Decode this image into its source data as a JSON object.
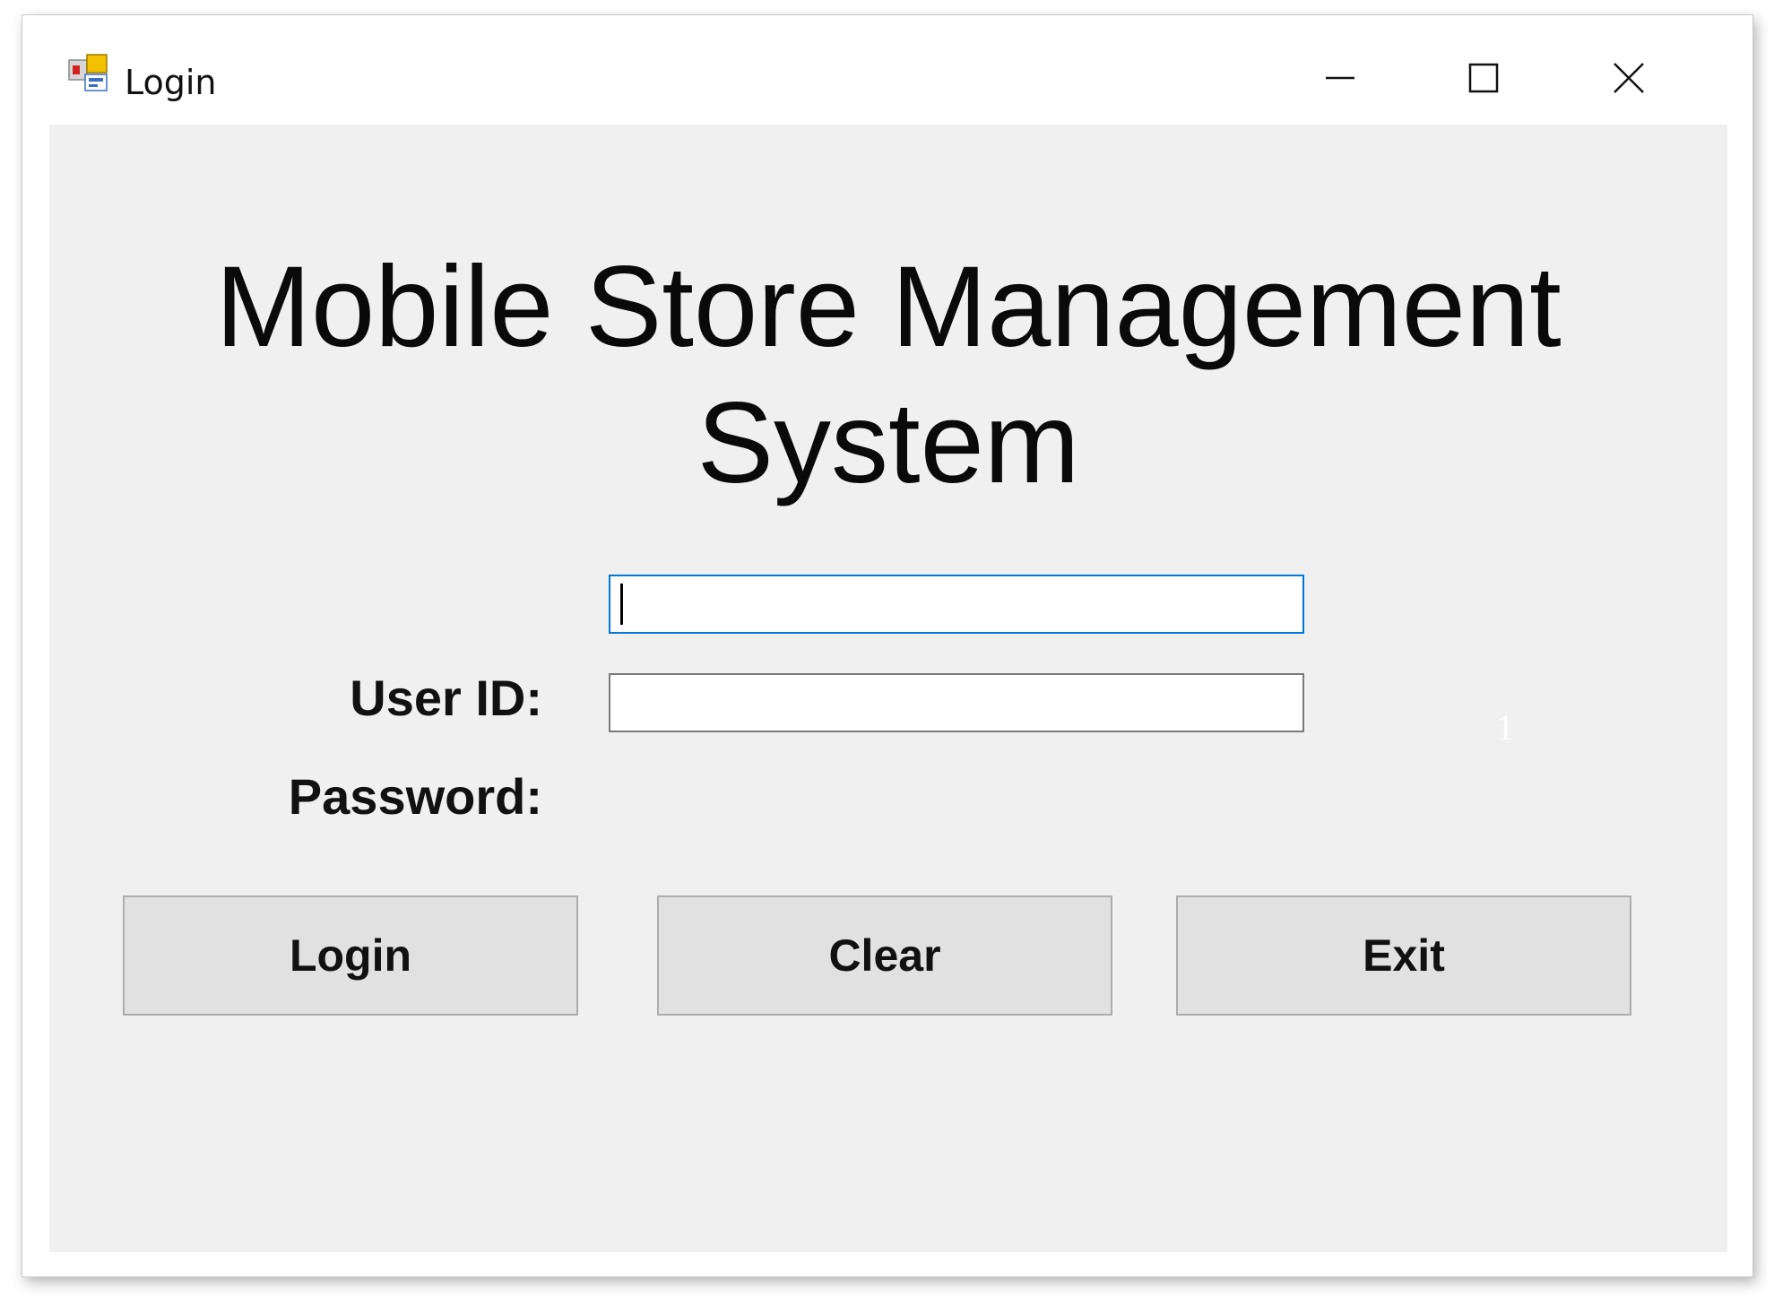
{
  "window": {
    "title": "Login",
    "icon": "windows-forms-app-icon",
    "controls": [
      "minimize-icon",
      "maximize-icon",
      "close-icon"
    ]
  },
  "form": {
    "heading_line1": "Mobile Store Management",
    "heading_line2": "System",
    "user_id_label": "User ID:",
    "user_id_value": "",
    "password_label": "Password:",
    "password_value": ""
  },
  "buttons": {
    "login": "Login",
    "clear": "Clear",
    "exit": "Exit"
  },
  "annotation": "1",
  "colors": {
    "client_background": "#f0f0f0",
    "focus_border": "#0078d7",
    "button_face": "#e1e1e1"
  }
}
